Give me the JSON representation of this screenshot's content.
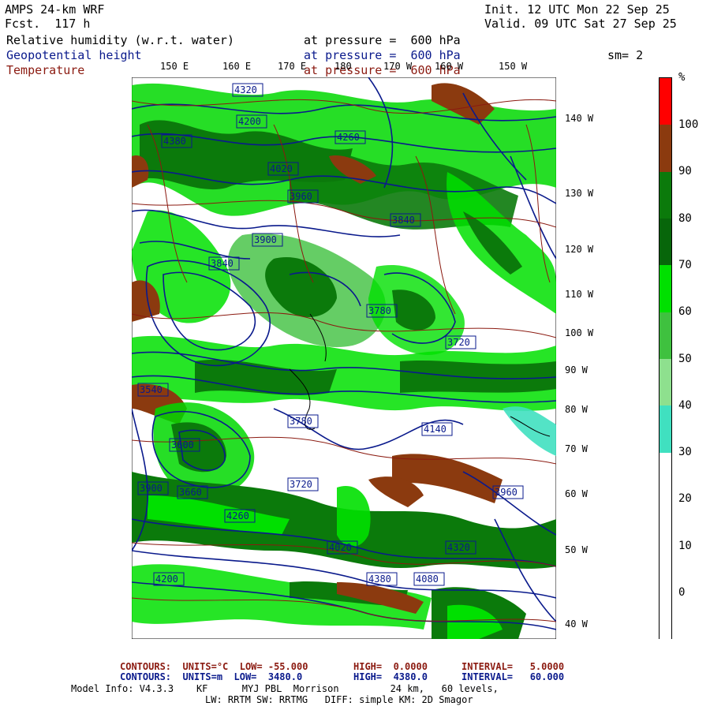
{
  "header": {
    "model": "AMPS 24-km WRF",
    "fcst": "Fcst.  117 h",
    "init": "Init. 12 UTC Mon 22 Sep 25",
    "valid": "Valid. 09 UTC Sat 27 Sep 25",
    "rh_label": "Relative humidity (w.r.t. water)",
    "rh_level": "at pressure =  600 hPa",
    "geo_label": "Geopotential height",
    "geo_level": "at pressure =  600 hPa",
    "temp_label": "Temperature",
    "temp_level": "at pressure =  600 hPa",
    "sm": "sm= 2"
  },
  "lon_top": [
    "150 E",
    "160 E",
    "170 E",
    "180",
    "170 W",
    "160 W",
    "150 W"
  ],
  "lon_right": [
    "140 W",
    "130 W",
    "120 W",
    "110 W",
    "100 W",
    "90 W",
    "80 W",
    "70 W",
    "60 W",
    "50 W",
    "40 W"
  ],
  "colorbar": {
    "unit": "%",
    "labels": [
      "100",
      "90",
      "80",
      "70",
      "60",
      "50",
      "40",
      "30",
      "20",
      "10",
      "0"
    ],
    "colors": [
      "#ff0000",
      "#8b3a0f",
      "#0b7a0b",
      "#07660a",
      "#00e000",
      "#3fc13f",
      "#8ee08e",
      "#40e0c0",
      "#ffffff",
      "#ffffff",
      "#ffffff",
      "#ffffff"
    ]
  },
  "height_labels": [
    "4320",
    "4200",
    "4380",
    "4260",
    "4020",
    "3960",
    "3900",
    "3840",
    "3780",
    "3720",
    "3660",
    "3600",
    "3540",
    "4140",
    "4080"
  ],
  "footer": {
    "line1_a": "CONTOURS:  UNITS=°C  LOW= -55.000",
    "line1_b": "HIGH=  0.0000",
    "line1_c": "INTERVAL=   5.0000",
    "line2_a": "CONTOURS:  UNITS=m  LOW=  3480.0",
    "line2_b": "HIGH=  4380.0",
    "line2_c": "INTERVAL=   60.000",
    "info1": "Model Info: V4.3.3    KF      MYJ PBL  Morrison         24 km,   60 levels,",
    "info2": "LW: RRTM SW: RRTMG   DIFF: simple KM: 2D Smagor"
  }
}
